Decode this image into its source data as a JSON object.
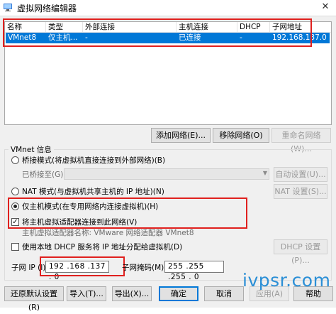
{
  "window": {
    "title": "虚拟网络编辑器",
    "close_glyph": "✕"
  },
  "table": {
    "headers": [
      "名称",
      "类型",
      "外部连接",
      "主机连接",
      "DHCP",
      "子网地址"
    ],
    "rows": [
      {
        "name": "VMnet8",
        "type": "仅主机...",
        "external": "-",
        "host": "已连接",
        "dhcp": "-",
        "subnet": "192.168.137.0"
      }
    ]
  },
  "list_buttons": {
    "add": "添加网络(E)...",
    "remove": "移除网络(O)",
    "rename": "重命名网络(W)..."
  },
  "vmnet_info": {
    "group_title": "VMnet 信息",
    "bridged_label": "桥接模式(将虚拟机直接连接到外部网络)(B)",
    "bridged_to_label": "已桥接至(G):",
    "auto_settings_button": "自动设置(U)...",
    "nat_label": "NAT 模式(与虚拟机共享主机的 IP 地址)(N)",
    "nat_settings_button": "NAT 设置(S)...",
    "hostonly_label": "仅主机模式(在专用网络内连接虚拟机)(H)",
    "connect_adapter_label": "将主机虚拟适配器连接到此网络(V)",
    "adapter_name_text": "主机虚拟适配器名称: VMware 网络适配器 VMnet8",
    "dhcp_label": "使用本地 DHCP 服务将 IP 地址分配给虚拟机(D)",
    "dhcp_settings_button": "DHCP 设置(P)...",
    "subnet_ip_label": "子网 IP (I):",
    "subnet_ip_value": "192 .168 .137 . 0",
    "subnet_mask_label": "子网掩码(M):",
    "subnet_mask_value": "255 .255 .255 . 0",
    "mode_selected": "hostonly",
    "connect_adapter_checked": true,
    "dhcp_checked": false
  },
  "bottom_buttons": {
    "restore": "还原默认设置(R)",
    "import": "导入(T)...",
    "export": "导出(X)...",
    "ok": "确定",
    "cancel": "取消",
    "apply": "应用(A)",
    "help": "帮助"
  },
  "watermark": "ivpsr.com",
  "colors": {
    "selection": "#0078d7",
    "annotation": "#e0201e",
    "watermark": "#2b8fd6"
  }
}
